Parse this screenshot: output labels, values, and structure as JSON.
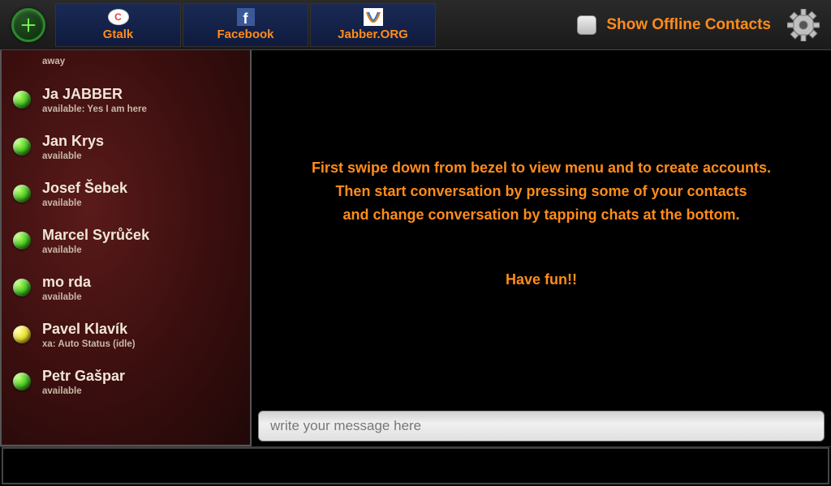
{
  "topbar": {
    "accounts": [
      {
        "label": "Gtalk",
        "icon": "gtalk"
      },
      {
        "label": "Facebook",
        "icon": "facebook"
      },
      {
        "label": "Jabber.ORG",
        "icon": "xmpp"
      }
    ],
    "show_offline_label": "Show Offline Contacts",
    "show_offline_checked": false
  },
  "contacts": [
    {
      "name": "",
      "status": "away",
      "presence": "green",
      "truncated_top": true
    },
    {
      "name": "Ja JABBER",
      "status": "available: Yes I am here",
      "presence": "green"
    },
    {
      "name": "Jan Krys",
      "status": "available",
      "presence": "green"
    },
    {
      "name": "Josef Šebek",
      "status": "available",
      "presence": "green"
    },
    {
      "name": "Marcel Syrůček",
      "status": "available",
      "presence": "green"
    },
    {
      "name": "mo rda",
      "status": "available",
      "presence": "green"
    },
    {
      "name": "Pavel Klavík",
      "status": "xa: Auto Status (idle)",
      "presence": "yellow"
    },
    {
      "name": "Petr Gašpar",
      "status": "available",
      "presence": "green"
    }
  ],
  "chat": {
    "instructions_line1": "First swipe down from bezel to view menu and to create accounts.",
    "instructions_line2": "Then start conversation by pressing some of your contacts",
    "instructions_line3": "and change conversation by tapping chats at the bottom.",
    "instructions_line4": "Have fun!!",
    "input_placeholder": "write your message here"
  }
}
